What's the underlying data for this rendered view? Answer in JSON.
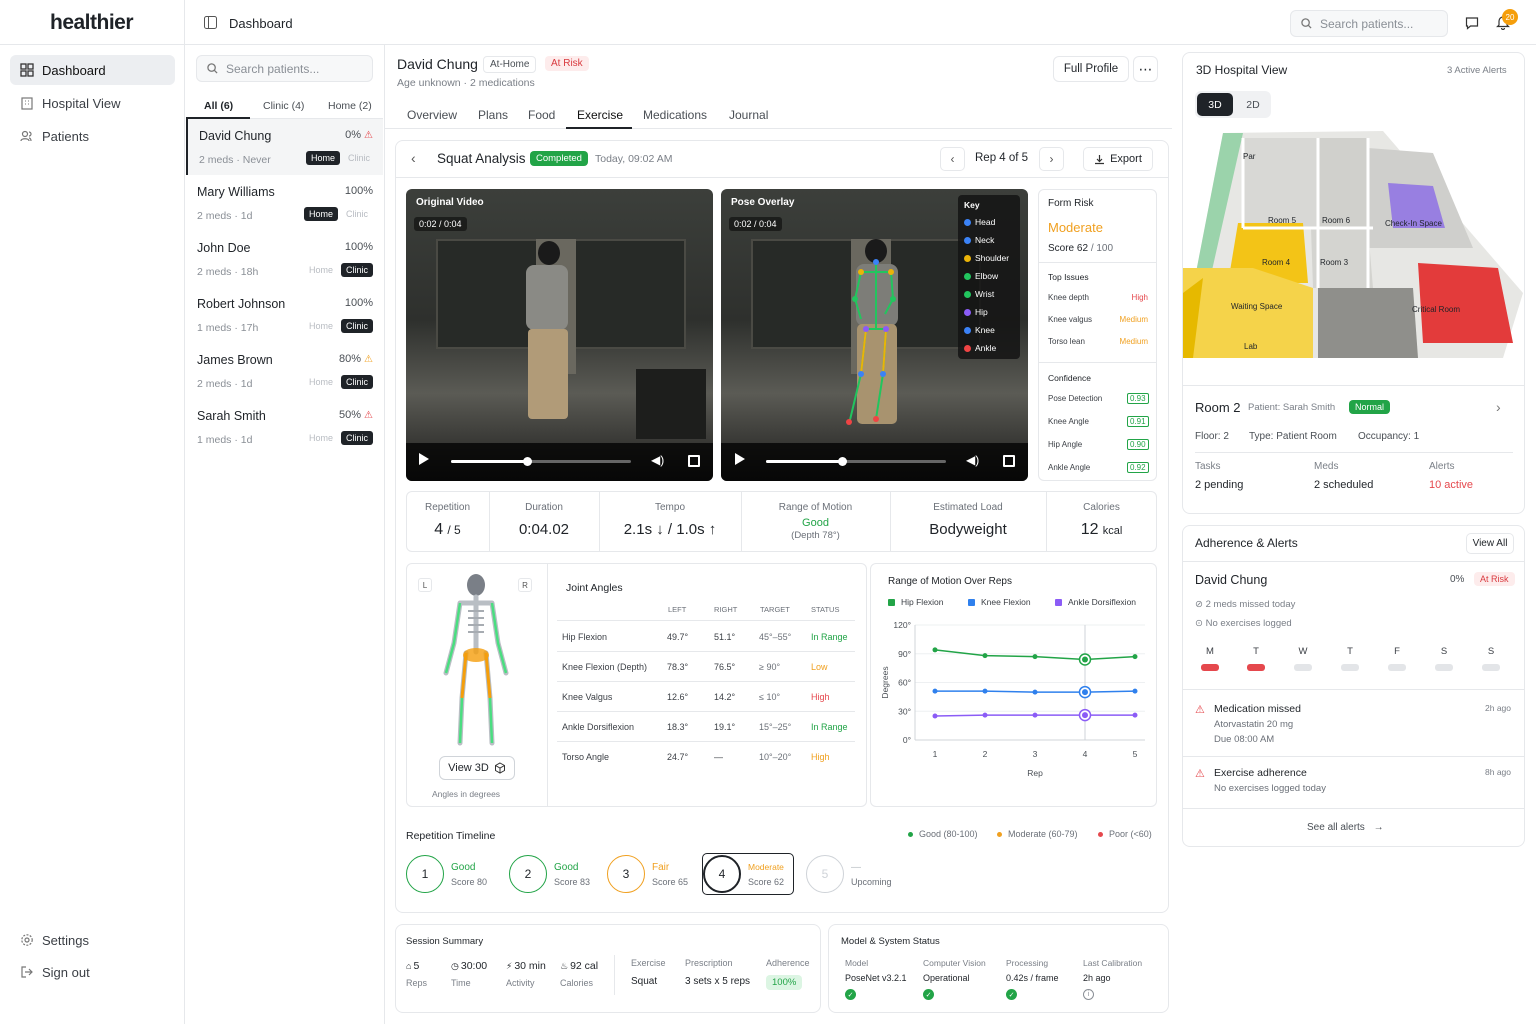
{
  "app": {
    "brand": "healthier"
  },
  "topbar": {
    "title": "Dashboard",
    "search_placeholder": "Search patients...",
    "notif_count": "20"
  },
  "sidebar": {
    "items": [
      {
        "label": "Dashboard"
      },
      {
        "label": "Hospital View"
      },
      {
        "label": "Patients"
      }
    ],
    "bottom": [
      {
        "label": "Settings"
      },
      {
        "label": "Sign out"
      }
    ]
  },
  "patients": {
    "search_placeholder": "Search patients...",
    "filters": [
      {
        "label": "All (6)"
      },
      {
        "label": "Clinic (4)"
      },
      {
        "label": "Home (2)"
      }
    ],
    "list": [
      {
        "name": "David Chung",
        "pct": "0%",
        "meta": "2 meds · Never",
        "home": "Home",
        "clinic": "Clinic",
        "active": "home",
        "warn": "red"
      },
      {
        "name": "Mary Williams",
        "pct": "100%",
        "meta": "2 meds · 1d",
        "home": "Home",
        "clinic": "Clinic",
        "active": "home",
        "warn": ""
      },
      {
        "name": "John Doe",
        "pct": "100%",
        "meta": "2 meds · 18h",
        "home": "Home",
        "clinic": "Clinic",
        "active": "clinic",
        "warn": ""
      },
      {
        "name": "Robert Johnson",
        "pct": "100%",
        "meta": "1 meds · 17h",
        "home": "Home",
        "clinic": "Clinic",
        "active": "clinic",
        "warn": ""
      },
      {
        "name": "James Brown",
        "pct": "80%",
        "meta": "2 meds · 1d",
        "home": "Home",
        "clinic": "Clinic",
        "active": "clinic",
        "warn": "orange"
      },
      {
        "name": "Sarah Smith",
        "pct": "50%",
        "meta": "1 meds · 1d",
        "home": "Home",
        "clinic": "Clinic",
        "active": "clinic",
        "warn": "red"
      }
    ]
  },
  "patient_header": {
    "name": "David Chung",
    "location_badge": "At-Home",
    "risk_badge": "At Risk",
    "subtitle": "Age unknown · 2 medications",
    "full_profile": "Full Profile",
    "tabs": [
      {
        "label": "Overview"
      },
      {
        "label": "Plans"
      },
      {
        "label": "Food"
      },
      {
        "label": "Exercise"
      },
      {
        "label": "Medications"
      },
      {
        "label": "Journal"
      }
    ]
  },
  "analysis": {
    "title": "Squat Analysis",
    "status": "Completed",
    "timestamp": "Today, 09:02 AM",
    "rep_nav": "Rep 4 of 5",
    "export": "Export",
    "video1": {
      "label": "Original Video",
      "time": "0:02 / 0:04",
      "progress": 0.42
    },
    "video2": {
      "label": "Pose Overlay",
      "time": "0:02 / 0:04",
      "progress": 0.42
    },
    "key": {
      "title": "Key",
      "items": [
        {
          "label": "Head",
          "color": "#3b82f6"
        },
        {
          "label": "Neck",
          "color": "#3b82f6"
        },
        {
          "label": "Shoulder",
          "color": "#eab308"
        },
        {
          "label": "Elbow",
          "color": "#22c55e"
        },
        {
          "label": "Wrist",
          "color": "#22c55e"
        },
        {
          "label": "Hip",
          "color": "#8b5cf6"
        },
        {
          "label": "Knee",
          "color": "#3b82f6"
        },
        {
          "label": "Ankle",
          "color": "#ef4444"
        }
      ]
    },
    "form_risk": {
      "title": "Form Risk",
      "level": "Moderate",
      "score_label": "Score",
      "score": "62",
      "score_max": "/ 100",
      "issues_title": "Top Issues",
      "issues": [
        {
          "name": "Knee depth",
          "level": "High",
          "color": "#e5484d"
        },
        {
          "name": "Knee valgus",
          "level": "Medium",
          "color": "#f0a020"
        },
        {
          "name": "Torso lean",
          "level": "Medium",
          "color": "#f0a020"
        }
      ],
      "confidence_title": "Confidence",
      "confidence": [
        {
          "name": "Pose Detection",
          "value": "0.93"
        },
        {
          "name": "Knee Angle",
          "value": "0.91"
        },
        {
          "name": "Hip Angle",
          "value": "0.90"
        },
        {
          "name": "Ankle Angle",
          "value": "0.92"
        }
      ]
    },
    "stats": {
      "repetition": {
        "label": "Repetition",
        "value": "4",
        "of": "/ 5"
      },
      "duration": {
        "label": "Duration",
        "value": "0:04.02"
      },
      "tempo": {
        "label": "Tempo",
        "value": "2.1s ↓ / 1.0s ↑"
      },
      "rom": {
        "label": "Range of Motion",
        "value": "Good",
        "sub": "(Depth 78°)"
      },
      "load": {
        "label": "Estimated Load",
        "value": "Bodyweight"
      },
      "calories": {
        "label": "Calories",
        "value": "12",
        "unit": "kcal"
      }
    },
    "skeleton": {
      "left": "L",
      "right": "R",
      "view3d": "View 3D",
      "note": "Angles in degrees"
    },
    "joint_angles": {
      "title": "Joint Angles",
      "headers": [
        "LEFT",
        "RIGHT",
        "TARGET",
        "STATUS"
      ],
      "rows": [
        {
          "name": "Hip Flexion",
          "left": "49.7°",
          "right": "51.1°",
          "target": "45°–55°",
          "status": "In Range",
          "color": "#22a447"
        },
        {
          "name": "Knee Flexion (Depth)",
          "left": "78.3°",
          "right": "76.5°",
          "target": "≥ 90°",
          "status": "Low",
          "color": "#f0a020"
        },
        {
          "name": "Knee Valgus",
          "left": "12.6°",
          "right": "14.2°",
          "target": "≤ 10°",
          "status": "High",
          "color": "#e5484d"
        },
        {
          "name": "Ankle Dorsiflexion",
          "left": "18.3°",
          "right": "19.1°",
          "target": "15°–25°",
          "status": "In Range",
          "color": "#22a447"
        },
        {
          "name": "Torso Angle",
          "left": "24.7°",
          "right": "—",
          "target": "10°–20°",
          "status": "High",
          "color": "#f0a020"
        }
      ]
    },
    "timeline": {
      "title": "Repetition Timeline",
      "legend": [
        {
          "label": "Good (80-100)",
          "color": "#22a447"
        },
        {
          "label": "Moderate (60-79)",
          "color": "#f0a020"
        },
        {
          "label": "Poor (<60)",
          "color": "#e5484d"
        }
      ],
      "reps": [
        {
          "n": "1",
          "status": "Good",
          "score": "Score 80",
          "color": "#22a447"
        },
        {
          "n": "2",
          "status": "Good",
          "score": "Score 83",
          "color": "#22a447"
        },
        {
          "n": "3",
          "status": "Fair",
          "score": "Score 65",
          "color": "#f0a020"
        },
        {
          "n": "4",
          "status": "Moderate",
          "score": "Score 62",
          "color": "#f0a020"
        },
        {
          "n": "5",
          "status": "—",
          "score": "Upcoming",
          "color": "#cfd3d8"
        }
      ]
    }
  },
  "chart_data": {
    "type": "line",
    "title": "Range of Motion Over Reps",
    "xlabel": "Rep",
    "ylabel": "Degrees",
    "x": [
      1,
      2,
      3,
      4,
      5
    ],
    "yticks": [
      "120°",
      "90°",
      "60°",
      "30°",
      "0°"
    ],
    "ylim": [
      0,
      120
    ],
    "grid": true,
    "legend_position": "top",
    "series": [
      {
        "name": "Hip Flexion",
        "color": "#22a447",
        "values": [
          94,
          88,
          87,
          84,
          87
        ]
      },
      {
        "name": "Knee Flexion",
        "color": "#2f80ed",
        "values": [
          51,
          51,
          50,
          50,
          51
        ]
      },
      {
        "name": "Ankle Dorsiflexion",
        "color": "#8b5cf6",
        "values": [
          25,
          26,
          26,
          26,
          26
        ]
      }
    ],
    "highlight_x": 4
  },
  "session_summary": {
    "title": "Session Summary",
    "metrics": [
      {
        "value": "5",
        "label": "Reps"
      },
      {
        "value": "30:00",
        "label": "Time"
      },
      {
        "value": "30 min",
        "label": "Activity"
      },
      {
        "value": "92 cal",
        "label": "Calories"
      }
    ],
    "exercise_label": "Exercise",
    "exercise": "Squat",
    "prescription_label": "Prescription",
    "prescription": "3 sets x 5 reps",
    "adherence_label": "Adherence",
    "adherence": "100%"
  },
  "model_status": {
    "title": "Model & System Status",
    "items": [
      {
        "label": "Model",
        "value": "PoseNet v3.2.1",
        "ok": true
      },
      {
        "label": "Computer Vision",
        "value": "Operational",
        "ok": true
      },
      {
        "label": "Processing",
        "value": "0.42s / frame",
        "ok": true
      },
      {
        "label": "Last Calibration",
        "value": "2h ago",
        "ok": false
      }
    ]
  },
  "hospital": {
    "title": "3D Hospital View",
    "alerts": "3 Active Alerts",
    "toggle_3d": "3D",
    "toggle_2d": "2D",
    "rooms": [
      "Par",
      "Room 5",
      "Room 6",
      "Check-In Space",
      "Room 4",
      "Room 3",
      "Waiting Space",
      "Critical Room",
      "Lab"
    ],
    "room_detail": {
      "name": "Room 2",
      "patient": "Patient: Sarah Smith",
      "status": "Normal",
      "floor": "Floor: 2",
      "type": "Type: Patient Room",
      "occupancy": "Occupancy: 1",
      "tasks_label": "Tasks",
      "tasks": "2 pending",
      "meds_label": "Meds",
      "meds": "2 scheduled",
      "alerts_label": "Alerts",
      "alerts": "10 active"
    }
  },
  "adherence": {
    "title": "Adherence & Alerts",
    "view_all": "View All",
    "patient": "David Chung",
    "pct": "0%",
    "risk": "At Risk",
    "meds_missed": "2 meds missed today",
    "no_ex": "No exercises logged",
    "days": [
      {
        "d": "M",
        "s": "missed"
      },
      {
        "d": "T",
        "s": "missed"
      },
      {
        "d": "W",
        "s": "none"
      },
      {
        "d": "T",
        "s": "none"
      },
      {
        "d": "F",
        "s": "none"
      },
      {
        "d": "S",
        "s": "none"
      },
      {
        "d": "S",
        "s": "none"
      }
    ],
    "alerts": [
      {
        "title": "Medication missed",
        "line1": "Atorvastatin 20 mg",
        "line2": "Due 08:00 AM",
        "time": "2h ago"
      },
      {
        "title": "Exercise adherence",
        "line1": "No exercises logged today",
        "line2": "",
        "time": "8h ago"
      }
    ],
    "see_all": "See all alerts"
  }
}
